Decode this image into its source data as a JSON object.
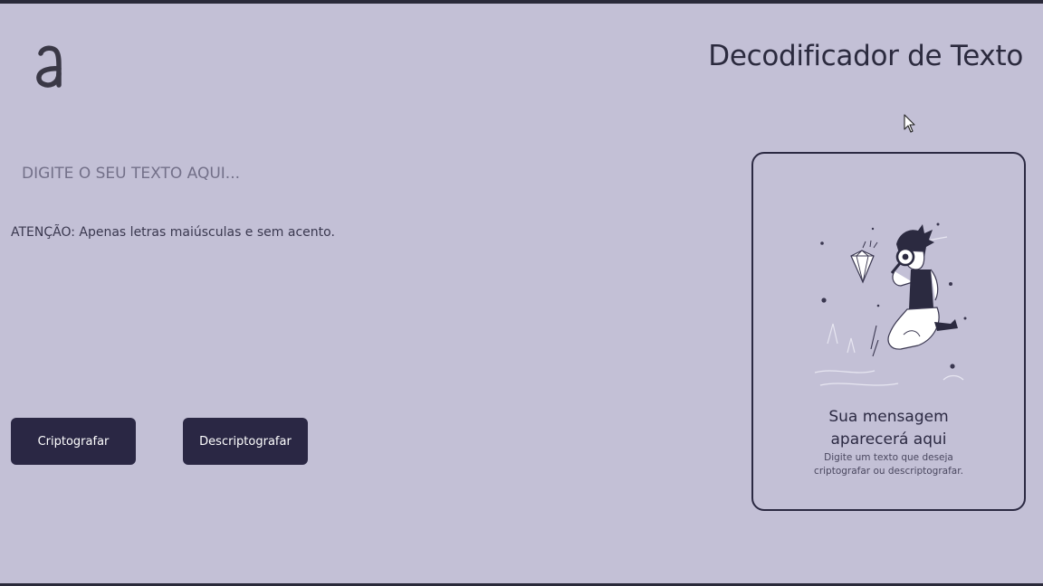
{
  "header": {
    "logo_glyph": "a",
    "title": "Decodificador de Texto"
  },
  "input": {
    "placeholder": "DIGITE O SEU TEXTO AQUI...",
    "value": ""
  },
  "warning": {
    "text": "ATENÇÃO: Apenas letras maiúsculas e sem acento."
  },
  "buttons": {
    "encrypt_label": "Criptografar",
    "decrypt_label": "Descriptografar"
  },
  "output": {
    "title_line1": "Sua mensagem",
    "title_line2": "aparecerá aqui",
    "desc_line1": "Digite um texto que deseja",
    "desc_line2": "criptografar ou descriptografar."
  },
  "colors": {
    "background": "#c3c0d6",
    "button": "#2a2744",
    "text_dark": "#2b2a3e"
  },
  "icons": {
    "logo": "alura-a-logo-icon",
    "cursor": "mouse-pointer-icon",
    "illustration": "person-with-magnifier-illustration"
  }
}
